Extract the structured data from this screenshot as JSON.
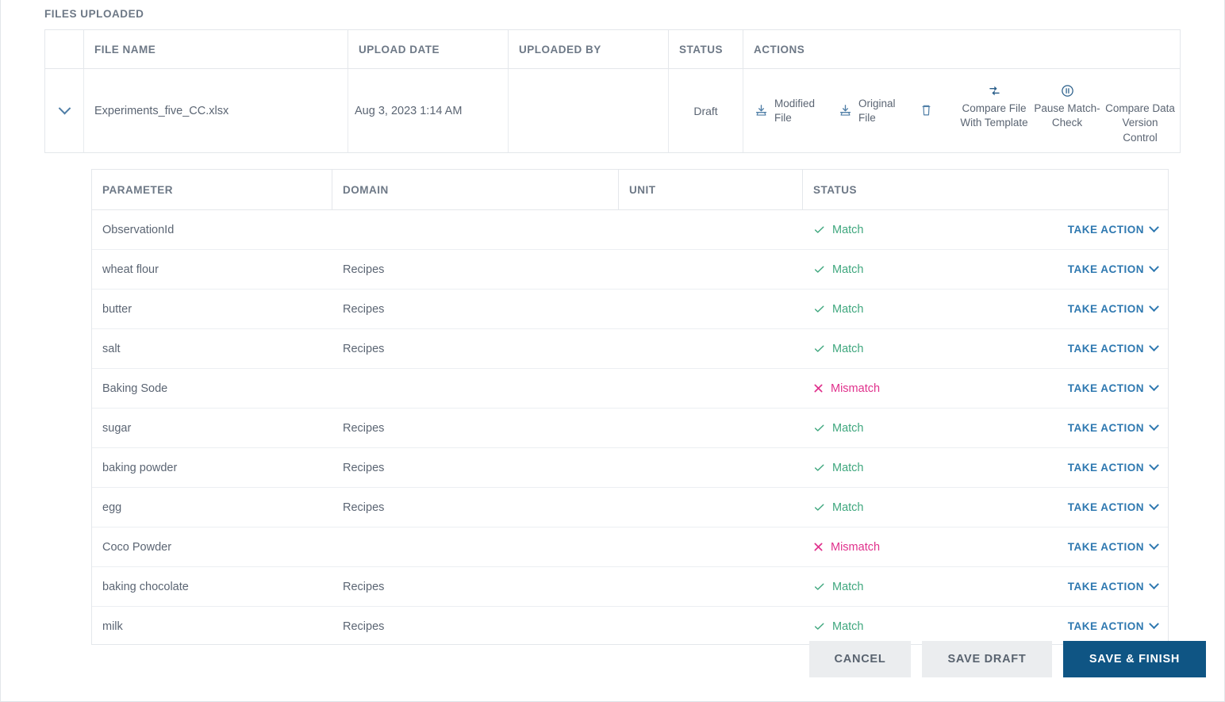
{
  "section": {
    "title": "FILES UPLOADED"
  },
  "colors": {
    "primary": "#0f5584",
    "link": "#2e78b0",
    "match": "#3fa77e",
    "mismatch": "#e0318c",
    "header_text": "#6d7886",
    "body_text": "#5b6573"
  },
  "files_table": {
    "columns": [
      "",
      "FILE NAME",
      "UPLOAD DATE",
      "UPLOADED BY",
      "STATUS",
      "ACTIONS"
    ],
    "row": {
      "expand_icon": "chevron-down-icon",
      "file_name": "Experiments_five_CC.xlsx",
      "upload_date": "Aug 3, 2023 1:14 AM",
      "uploaded_by": "",
      "status": "Draft",
      "actions": [
        {
          "icon": "download-icon",
          "label": "Modified File",
          "style": "inline"
        },
        {
          "icon": "download-icon",
          "label": "Original File",
          "style": "inline"
        },
        {
          "icon": "trash-icon",
          "label": "",
          "style": "icon-only"
        },
        {
          "icon": "compare-icon",
          "label": "Compare File With Template",
          "style": "stacked"
        },
        {
          "icon": "pause-circle-icon",
          "label": "Pause Match-Check",
          "style": "stacked"
        },
        {
          "icon": "",
          "label": "Compare Data Version Control",
          "style": "stacked"
        }
      ]
    }
  },
  "parameters_table": {
    "columns": [
      "PARAMETER",
      "DOMAIN",
      "UNIT",
      "STATUS"
    ],
    "action_label": "TAKE ACTION",
    "rows": [
      {
        "parameter": "ObservationId",
        "domain": "",
        "unit": "",
        "status": "Match",
        "status_type": "match"
      },
      {
        "parameter": "wheat flour",
        "domain": "Recipes",
        "unit": "",
        "status": "Match",
        "status_type": "match"
      },
      {
        "parameter": "butter",
        "domain": "Recipes",
        "unit": "",
        "status": "Match",
        "status_type": "match"
      },
      {
        "parameter": "salt",
        "domain": "Recipes",
        "unit": "",
        "status": "Match",
        "status_type": "match"
      },
      {
        "parameter": "Baking Sode",
        "domain": "",
        "unit": "",
        "status": "Mismatch",
        "status_type": "mismatch"
      },
      {
        "parameter": "sugar",
        "domain": "Recipes",
        "unit": "",
        "status": "Match",
        "status_type": "match"
      },
      {
        "parameter": "baking powder",
        "domain": "Recipes",
        "unit": "",
        "status": "Match",
        "status_type": "match"
      },
      {
        "parameter": "egg",
        "domain": "Recipes",
        "unit": "",
        "status": "Match",
        "status_type": "match"
      },
      {
        "parameter": "Coco Powder",
        "domain": "",
        "unit": "",
        "status": "Mismatch",
        "status_type": "mismatch"
      },
      {
        "parameter": "baking chocolate",
        "domain": "Recipes",
        "unit": "",
        "status": "Match",
        "status_type": "match"
      },
      {
        "parameter": "milk",
        "domain": "Recipes",
        "unit": "",
        "status": "Match",
        "status_type": "match"
      }
    ]
  },
  "footer": {
    "cancel_label": "CANCEL",
    "save_draft_label": "SAVE DRAFT",
    "save_finish_label": "SAVE & FINISH"
  }
}
